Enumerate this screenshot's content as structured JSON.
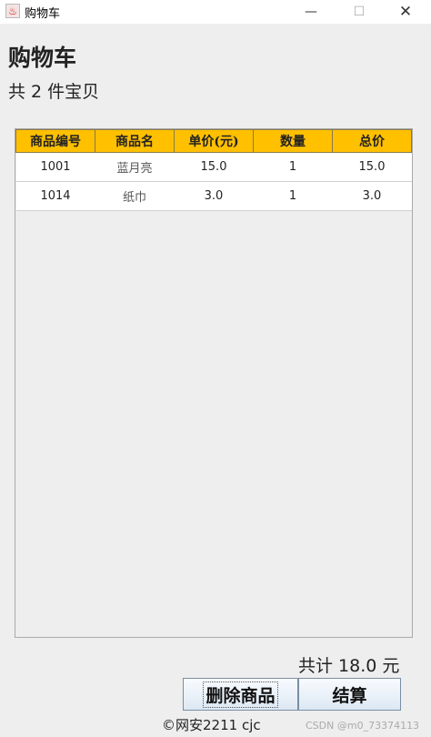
{
  "window": {
    "title": "购物车",
    "minimize_glyph": "—",
    "maximize_glyph": "☐",
    "close_glyph": "✕",
    "app_icon": "java-cup-icon"
  },
  "header": {
    "heading": "购物车",
    "item_count": "共 2 件宝贝"
  },
  "table": {
    "columns": [
      "商品编号",
      "商品名",
      "单价(元)",
      "数量",
      "总价"
    ],
    "rows": [
      [
        "1001",
        "蓝月亮",
        "15.0",
        "1",
        "15.0"
      ],
      [
        "1014",
        "纸巾",
        "3.0",
        "1",
        "3.0"
      ]
    ],
    "header_color": "#ffc000"
  },
  "summary": {
    "total": "共计 18.0 元"
  },
  "actions": {
    "delete_label": "删除商品",
    "checkout_label": "结算"
  },
  "footer": {
    "credit": "©网安2211 cjc",
    "watermark": "CSDN @m0_73374113"
  }
}
